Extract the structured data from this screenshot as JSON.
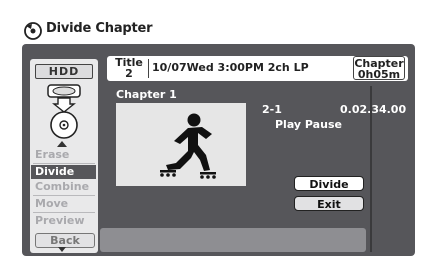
{
  "window": {
    "title": "Divide Chapter"
  },
  "sidebar": {
    "badge": "HDD",
    "menu": [
      {
        "label": "Erase",
        "active": false
      },
      {
        "label": "Divide",
        "active": true
      },
      {
        "label": "Combine",
        "active": false
      },
      {
        "label": "Move",
        "active": false
      },
      {
        "label": "Preview",
        "active": false
      }
    ],
    "back_label": "Back"
  },
  "info_bar": {
    "title_line1": "Title",
    "title_line2": "2",
    "details": "10/07Wed  3:00PM  2ch LP",
    "chapter_line1": "Chapter",
    "chapter_line2": "0h05m"
  },
  "main": {
    "chapter_label": "Chapter 1",
    "clip_number": "2-1",
    "timecode": "0.02.34.00",
    "status": "Play Pause"
  },
  "actions": {
    "divide_label": "Divide",
    "exit_label": "Exit"
  },
  "colors": {
    "frame": "#56565a",
    "sidebar": "#e9e9ea",
    "active_item": "#56565a",
    "inactive_item_text": "#a9a9ad",
    "bottom_bar": "#8e8e92"
  },
  "icons": {
    "title_icon": "disc-menu-icon",
    "hdd_icon": "hdd-to-disc-icon",
    "preview_icon": "skater-icon"
  }
}
